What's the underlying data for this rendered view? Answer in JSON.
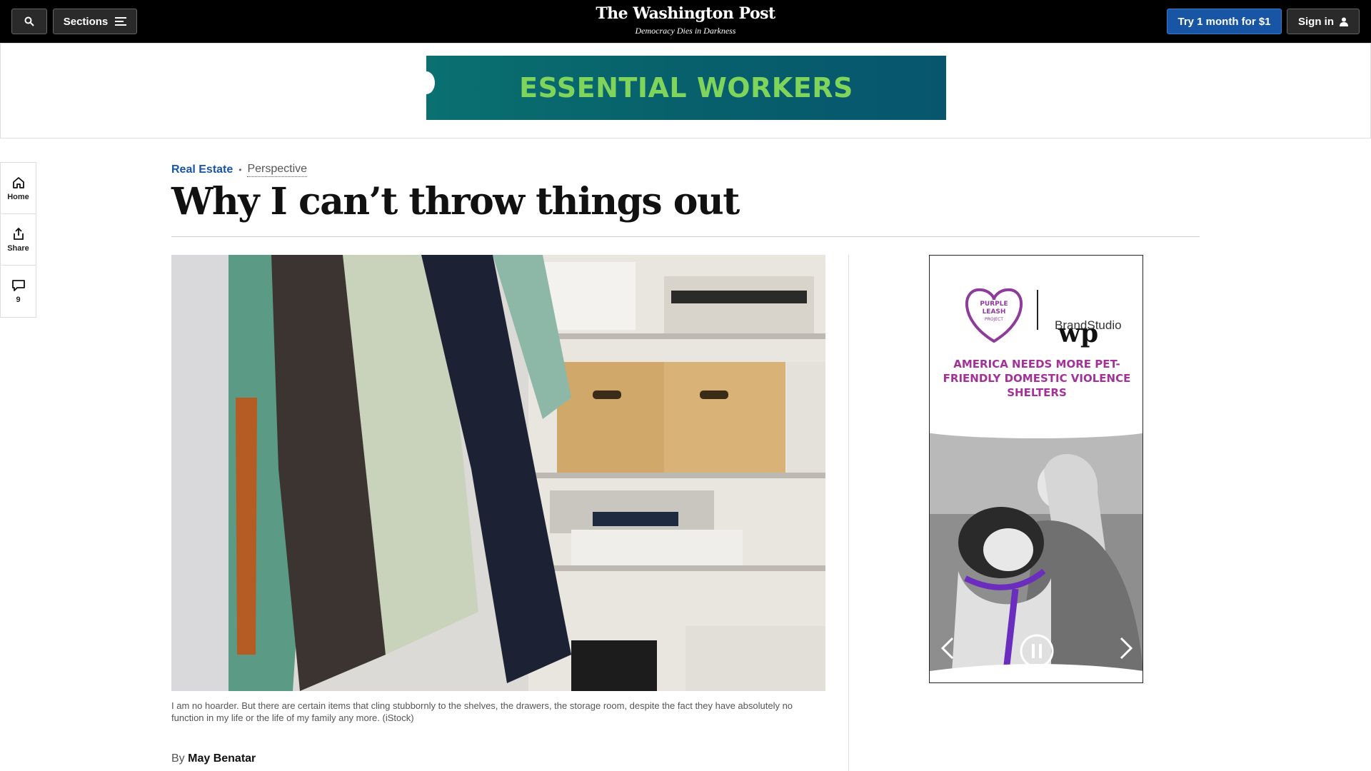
{
  "nav": {
    "sections_label": "Sections",
    "logo_name": "The Washington Post",
    "tagline": "Democracy Dies in Darkness",
    "subscribe_label": "Try 1 month for $1",
    "signin_label": "Sign in"
  },
  "top_ad": {
    "text": "ESSENTIAL WORKERS"
  },
  "rail": {
    "home_label": "Home",
    "share_label": "Share",
    "comments_count": "9"
  },
  "article": {
    "section": "Real Estate",
    "label": "Perspective",
    "headline": "Why I can’t throw things out",
    "caption": "I am no hoarder. But there are certain items that cling stubbornly to the shelves, the drawers, the storage room, despite the fact they have absolutely no function in my life or the life of my family any more. (iStock)",
    "byline_prefix": "By",
    "author": "May Benatar"
  },
  "side_ad": {
    "org_line1": "PURPLE",
    "org_line2": "LEASH",
    "org_line3": "PROJECT",
    "brand": "BrandStudio",
    "wp_mark": "wp",
    "message": "AMERICA NEEDS MORE PET-FRIENDLY DOMESTIC VIOLENCE SHELTERS"
  },
  "colors": {
    "nav_bg": "#000000",
    "subscribe_blue": "#1955a5",
    "section_blue": "#1955a5",
    "ad_teal": "#0a7070",
    "ad_green_text": "#7fd45b",
    "ad_purple": "#a3319a"
  }
}
